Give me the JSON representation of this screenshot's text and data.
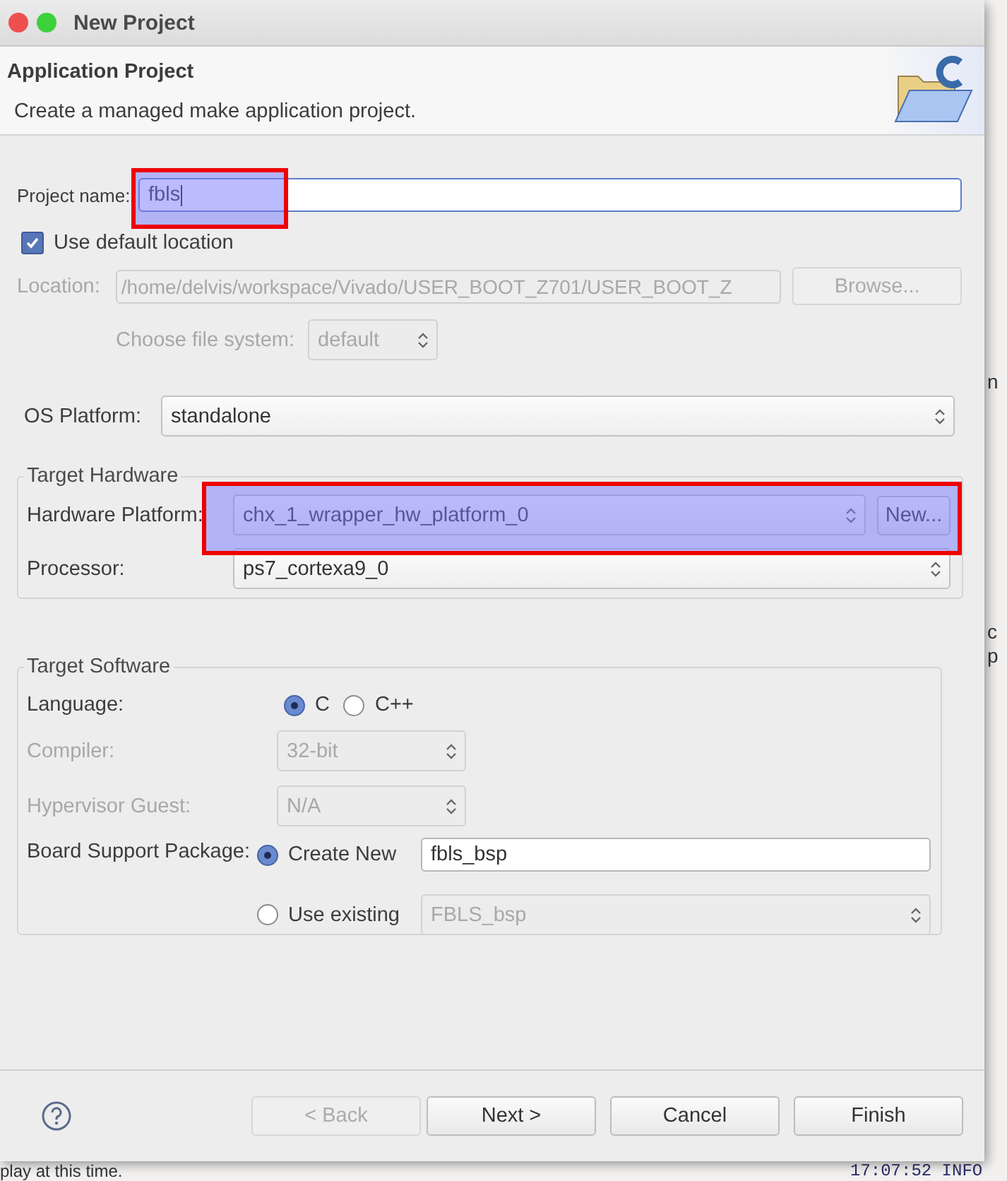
{
  "window": {
    "title": "New Project"
  },
  "header": {
    "title": "Application Project",
    "description": "Create a managed make application project."
  },
  "project_name": {
    "label": "Project name:",
    "value": "fbls"
  },
  "use_default_location": {
    "label": "Use default location",
    "checked": true
  },
  "location": {
    "label": "Location:",
    "value": "/home/delvis/workspace/Vivado/USER_BOOT_Z701/USER_BOOT_Z",
    "disabled": true,
    "button": "Browse..."
  },
  "file_system": {
    "label": "Choose file system:",
    "value": "default",
    "disabled": true
  },
  "os_platform": {
    "label": "OS Platform:",
    "value": "standalone"
  },
  "target_hardware": {
    "title": "Target Hardware",
    "hardware_platform": {
      "label": "Hardware Platform:",
      "value": "chx_1_wrapper_hw_platform_0",
      "button": "New..."
    },
    "processor": {
      "label": "Processor:",
      "value": "ps7_cortexa9_0"
    }
  },
  "target_software": {
    "title": "Target Software",
    "language": {
      "label": "Language:",
      "options": [
        {
          "label": "C",
          "selected": true
        },
        {
          "label": "C++",
          "selected": false
        }
      ]
    },
    "compiler": {
      "label": "Compiler:",
      "value": "32-bit",
      "disabled": true
    },
    "hypervisor_guest": {
      "label": "Hypervisor Guest:",
      "value": "N/A",
      "disabled": true
    },
    "board_support_package": {
      "label": "Board Support Package:",
      "create_new": {
        "label": "Create New",
        "selected": true,
        "value": "fbls_bsp"
      },
      "use_existing": {
        "label": "Use existing",
        "selected": false,
        "value": "FBLS_bsp"
      }
    }
  },
  "buttons": [
    {
      "label": "< Back",
      "disabled": true
    },
    {
      "label": "Next >",
      "disabled": false
    },
    {
      "label": "Cancel",
      "disabled": false
    },
    {
      "label": "Finish",
      "disabled": false
    }
  ],
  "background": {
    "fragments": [
      "n",
      "c",
      "p"
    ],
    "status_text": "play at this time.",
    "log_text": "17:07:52 INFO"
  }
}
